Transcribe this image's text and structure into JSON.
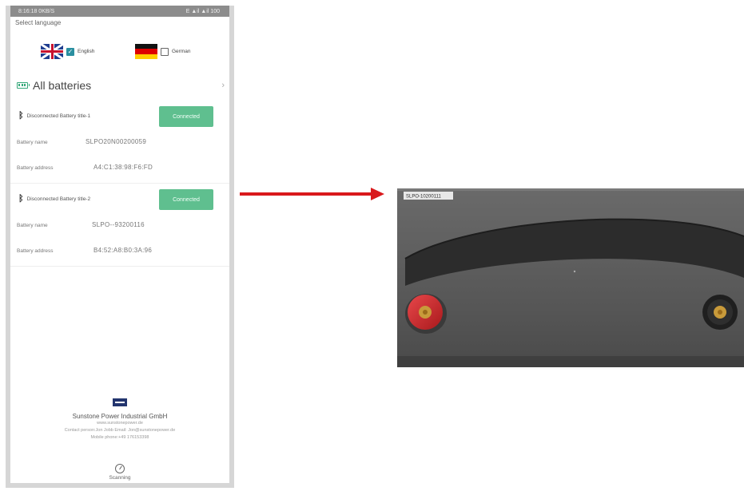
{
  "status_bar": {
    "left": "8:16:18 0KB/S",
    "right": "E ▲il ▲il 100"
  },
  "language": {
    "title": "Select language",
    "options": [
      {
        "label": "English",
        "checked": true
      },
      {
        "label": "German",
        "checked": false
      }
    ]
  },
  "all_batteries": {
    "label": "All batteries",
    "chevron": "›"
  },
  "batteries": [
    {
      "title": "Disconnected Battery title-1",
      "button": "Connected",
      "name_label": "Battery name",
      "name_value": "SLPO20N00200059",
      "address_label": "Battery address",
      "address_value": "A4:C1:38:98:F6:FD"
    },
    {
      "title": "Disconnected Battery title-2",
      "button": "Connected",
      "name_label": "Battery name",
      "name_value": "SLPO--93200116",
      "address_label": "Battery address",
      "address_value": "B4:52:A8:B0:3A:96"
    }
  ],
  "footer": {
    "company": "Sunstone Power Industrial GmbH",
    "website": "www.sunstonepower.de",
    "contact": "Contact person:Jon Jobb Email: Jon@sunstonepower.de",
    "phone": "Mobile phone:+49 176153398"
  },
  "scan": {
    "label": "Scanning"
  },
  "battery_photo": {
    "sticker": "SLPO-10200111"
  },
  "colors": {
    "accent": "#5fbf8f",
    "arrow": "#d9191c",
    "battery": "#5c5c5c"
  },
  "icons": [
    "bluetooth-icon",
    "battery-icon",
    "scan-icon",
    "chevron-right-icon"
  ]
}
